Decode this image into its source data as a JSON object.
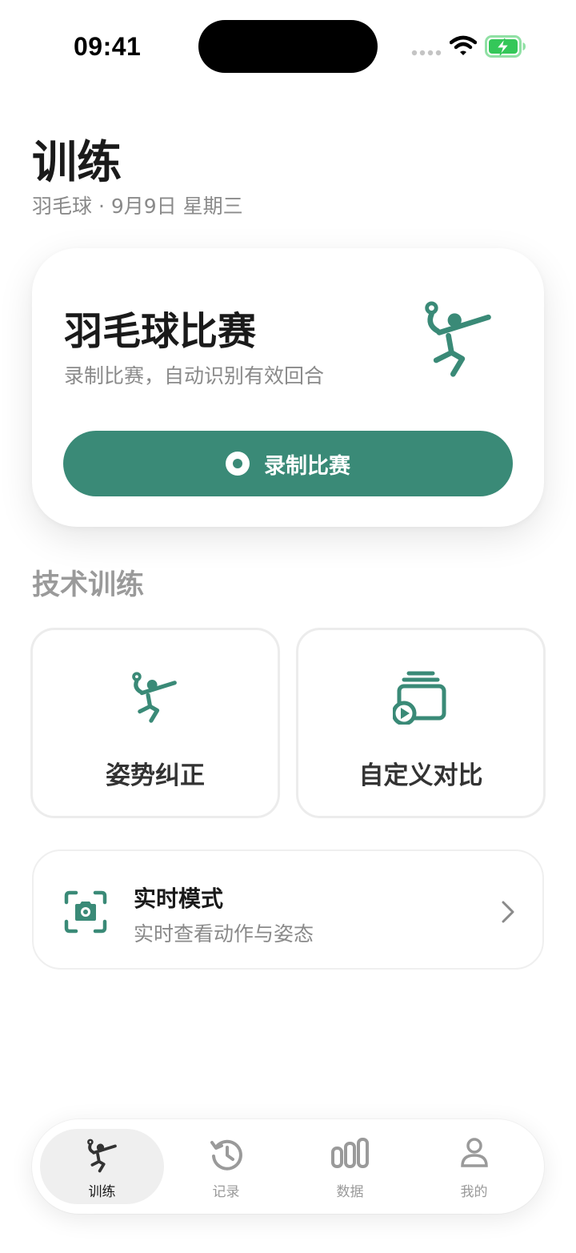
{
  "status": {
    "time": "09:41"
  },
  "header": {
    "title": "训练",
    "subtitle": "羽毛球 · 9月9日 星期三"
  },
  "hero": {
    "title": "羽毛球比赛",
    "description": "录制比赛，自动识别有效回合",
    "button_label": "录制比赛",
    "icon": "badminton-player-icon"
  },
  "technique": {
    "section_title": "技术训练",
    "tiles": [
      {
        "label": "姿势纠正",
        "icon": "badminton-player-icon"
      },
      {
        "label": "自定义对比",
        "icon": "stacked-videos-icon"
      }
    ]
  },
  "live_mode": {
    "title": "实时模式",
    "description": "实时查看动作与姿态",
    "icon": "camera-scan-icon"
  },
  "tab_bar": {
    "tabs": [
      {
        "label": "训练",
        "icon": "badminton-player-icon",
        "active": true
      },
      {
        "label": "记录",
        "icon": "history-icon",
        "active": false
      },
      {
        "label": "数据",
        "icon": "bar-chart-icon",
        "active": false
      },
      {
        "label": "我的",
        "icon": "person-icon",
        "active": false
      }
    ]
  },
  "colors": {
    "accent": "#3a8a77",
    "battery": "#34c759",
    "secondary_text": "#8a8a8a"
  }
}
